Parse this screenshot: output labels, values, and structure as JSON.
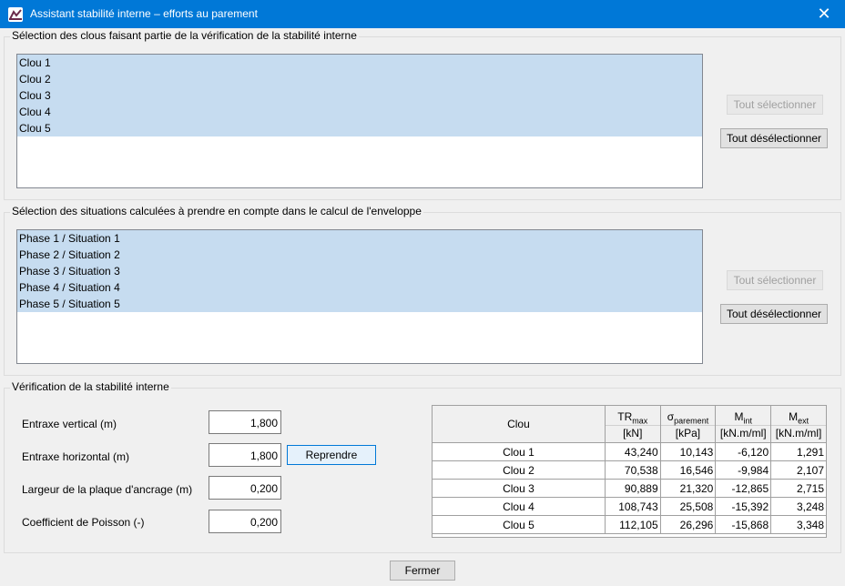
{
  "window": {
    "title": "Assistant stabilité interne – efforts au parement",
    "close_glyph": "✕"
  },
  "nails_group": {
    "title": "Sélection des clous faisant partie de la vérification de la stabilité interne",
    "items": [
      "Clou 1",
      "Clou 2",
      "Clou 3",
      "Clou 4",
      "Clou 5"
    ],
    "select_all": "Tout sélectionner",
    "deselect_all": "Tout désélectionner"
  },
  "situations_group": {
    "title": "Sélection des situations calculées à prendre en compte dans le calcul de l'enveloppe",
    "items": [
      "Phase 1 / Situation 1",
      "Phase 2 / Situation 2",
      "Phase 3 / Situation 3",
      "Phase 4 / Situation 4",
      "Phase 5 / Situation 5"
    ],
    "select_all": "Tout sélectionner",
    "deselect_all": "Tout désélectionner"
  },
  "verification_group": {
    "title": "Vérification de la stabilité interne",
    "fields": [
      {
        "label": "Entraxe vertical (m)",
        "value": "1,800"
      },
      {
        "label": "Entraxe horizontal (m)",
        "value": "1,800"
      },
      {
        "label": "Largeur de la plaque d'ancrage (m)",
        "value": "0,200"
      },
      {
        "label": "Coefficient de Poisson (-)",
        "value": "0,200"
      }
    ],
    "reprendre": "Reprendre",
    "table": {
      "col_clou": "Clou",
      "columns": [
        {
          "name": "TR",
          "sub": "max",
          "unit": "[kN]"
        },
        {
          "name": "σ",
          "sub": "parement",
          "unit": "[kPa]"
        },
        {
          "name": "M",
          "sub": "int",
          "unit": "[kN.m/ml]"
        },
        {
          "name": "M",
          "sub": "ext",
          "unit": "[kN.m/ml]"
        }
      ],
      "rows": [
        {
          "clou": "Clou 1",
          "tr": "43,240",
          "sigma": "10,143",
          "mint": "-6,120",
          "mext": "1,291"
        },
        {
          "clou": "Clou 2",
          "tr": "70,538",
          "sigma": "16,546",
          "mint": "-9,984",
          "mext": "2,107"
        },
        {
          "clou": "Clou 3",
          "tr": "90,889",
          "sigma": "21,320",
          "mint": "-12,865",
          "mext": "2,715"
        },
        {
          "clou": "Clou 4",
          "tr": "108,743",
          "sigma": "25,508",
          "mint": "-15,392",
          "mext": "3,248"
        },
        {
          "clou": "Clou 5",
          "tr": "112,105",
          "sigma": "26,296",
          "mint": "-15,868",
          "mext": "3,348"
        }
      ]
    }
  },
  "footer": {
    "close_label": "Fermer"
  },
  "colors": {
    "titlebar": "#0078d7",
    "selection": "#c6dcf0"
  }
}
